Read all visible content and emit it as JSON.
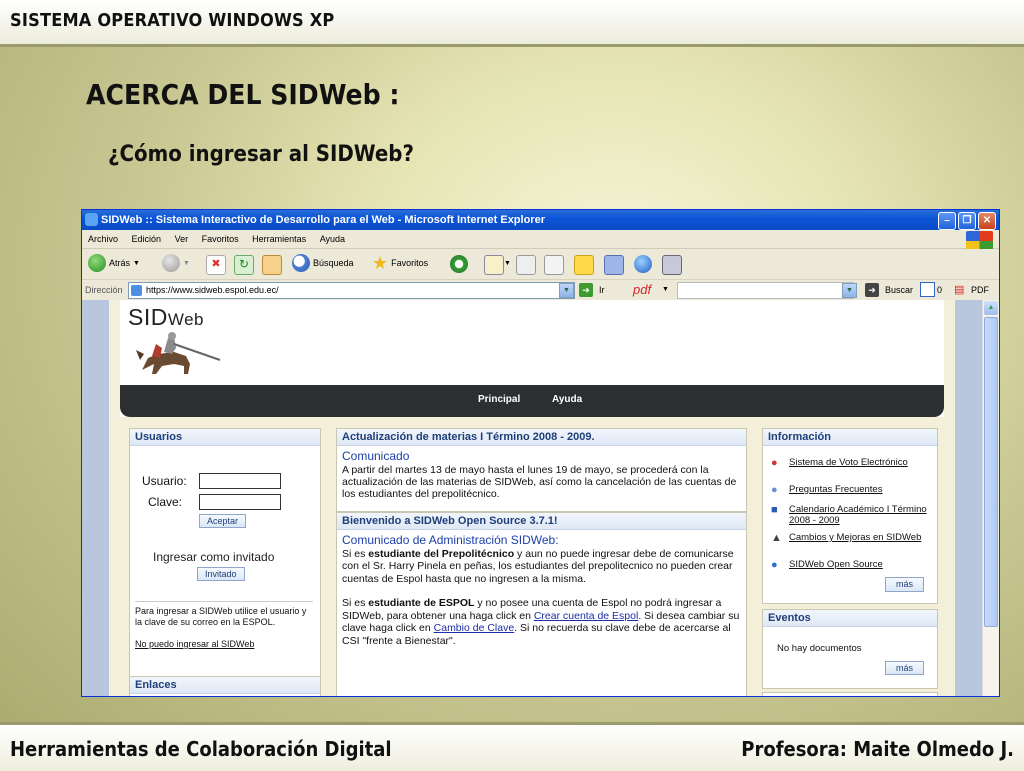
{
  "slide": {
    "top_title": "SISTEMA OPERATIVO WINDOWS XP",
    "title": "ACERCA DEL SIDWeb :",
    "subtitle": "¿Cómo ingresar al SIDWeb?",
    "footer_left": "Herramientas de Colaboración Digital",
    "footer_right": "Profesora: Maite Olmedo J."
  },
  "browser": {
    "window_title": "SIDWeb :: Sistema Interactivo de Desarrollo para el Web - Microsoft Internet Explorer",
    "menu": [
      "Archivo",
      "Edición",
      "Ver",
      "Favoritos",
      "Herramientas",
      "Ayuda"
    ],
    "toolbar": {
      "back": "Atrás",
      "search": "Búsqueda",
      "favorites": "Favoritos"
    },
    "address_label": "Dirección",
    "url": "https://www.sidweb.espol.edu.ec/",
    "go": "Ir",
    "pdf_label": "pdf",
    "buscar": "Buscar",
    "count": "0",
    "pdf_button": "PDF"
  },
  "site": {
    "logo_main": "SID",
    "logo_sub": "Web",
    "nav": [
      "Principal",
      "Ayuda"
    ],
    "usuarios": {
      "title": "Usuarios",
      "user_label": "Usuario:",
      "pass_label": "Clave:",
      "accept": "Aceptar",
      "guest_text": "Ingresar como invitado",
      "guest_button": "Invitado",
      "help_text": "Para ingresar a SIDWeb utilice el usuario y la clave de su correo en la ESPOL.",
      "cant_login": "No puedo ingresar al SIDWeb"
    },
    "enlaces_title": "Enlaces",
    "actualizacion": {
      "title": "Actualización de materias I Término 2008 - 2009.",
      "heading": "Comunicado",
      "text": "A partir del martes 13 de mayo hasta el lunes 19 de mayo, se procederá con la actualización de las materias de SIDWeb, así como la cancelación de las cuentas de los estudiantes del prepolitécnico."
    },
    "bienvenido": {
      "title": "Bienvenido a SIDWeb Open Source 3.7.1!",
      "heading": "Comunicado de Administración SIDWeb:",
      "p1_a": "Si es ",
      "p1_b": "estudiante del Prepolitécnico",
      "p1_c": " y aun no puede ingresar debe de comunicarse con el Sr. Harry Pinela en peñas, los estudiantes del prepolitecnico no pueden crear cuentas de Espol hasta que no ingresen a la misma.",
      "p2_a": "Si es ",
      "p2_b": "estudiante de ESPOL",
      "p2_c": " y no posee una cuenta de Espol no podrá ingresar a SIDWeb, para obtener una haga click en ",
      "p2_link1": "Crear cuenta de Espol",
      "p2_d": ". Si desea cambiar su clave haga click en ",
      "p2_link2": "Cambio de Clave",
      "p2_e": ". Si no recuerda su clave debe de acercarse al CSI \"frente a Bienestar\"."
    },
    "informacion": {
      "title": "Información",
      "items": [
        "Sistema de Voto Electrónico",
        "Preguntas Frecuentes",
        "Calendario Académico I Término 2008 - 2009",
        "Cambios y Mejoras en SIDWeb",
        "SIDWeb Open Source"
      ],
      "more": "más"
    },
    "eventos": {
      "title": "Eventos",
      "text": "No hay documentos",
      "more": "más"
    }
  }
}
